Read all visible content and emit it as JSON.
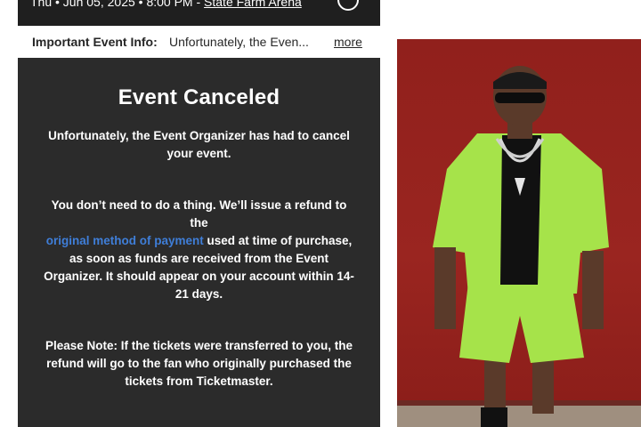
{
  "event": {
    "date_line": "Thu • Jun 05, 2025 • 8:00 PM",
    "venue_sep": " - ",
    "venue": "State Farm Arena"
  },
  "info_bar": {
    "label": "Important Event Info:",
    "text": "Unfortunately, the Even...",
    "more": "more"
  },
  "panel": {
    "title": "Event Canceled",
    "p1": "Unfortunately, the Event Organizer has had to cancel your event.",
    "p2_a": "You don’t need to do a thing. We’ll issue a refund to the",
    "p2_link": "original method of payment",
    "p2_b": "used at time of purchase, as soon as funds are received from the Event Organizer. It should appear on your account within 14-21 days.",
    "p3": "Please Note: If the tickets were transferred to you, the refund will go to the fan who originally purchased the tickets from Ticketmaster."
  },
  "colors": {
    "panel_bg": "#2b2b2b",
    "link": "#3f7ed8",
    "photo_bg": "#9a2520",
    "outfit": "#a6e34a"
  },
  "icons": [
    "share-icon"
  ]
}
